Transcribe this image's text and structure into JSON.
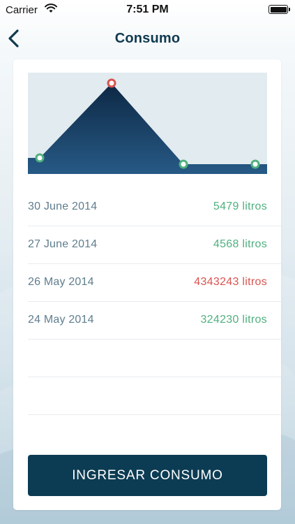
{
  "status_bar": {
    "carrier": "Carrier",
    "time": "7:51 PM",
    "wifi_icon": "wifi-icon",
    "battery_icon": "battery-icon"
  },
  "nav": {
    "title": "Consumo",
    "back_icon": "chevron-left-icon"
  },
  "chart_data": {
    "type": "area",
    "x": [
      "24 May 2014",
      "26 May 2014",
      "27 June 2014",
      "30 June 2014"
    ],
    "values": [
      324230,
      4343243,
      4568,
      5479
    ],
    "unit": "litros",
    "highlight_index": 1,
    "fill_color": "#1c4d72",
    "background_color": "#e2ebef",
    "point_ok_color": "#4fb07f",
    "point_alert_color": "#d9534f"
  },
  "records": [
    {
      "date": "30 June 2014",
      "amount": "5479 litros",
      "status": "ok"
    },
    {
      "date": "27 June 2014",
      "amount": "4568 litros",
      "status": "ok"
    },
    {
      "date": "26 May 2014",
      "amount": "4343243 litros",
      "status": "alert"
    },
    {
      "date": "24 May 2014",
      "amount": "324230 litros",
      "status": "ok"
    }
  ],
  "cta": {
    "label": "INGRESAR CONSUMO"
  },
  "colors": {
    "primary": "#0c3c53",
    "ok": "#4fb07f",
    "alert": "#d9534f",
    "text_muted": "#5f7d8e"
  }
}
